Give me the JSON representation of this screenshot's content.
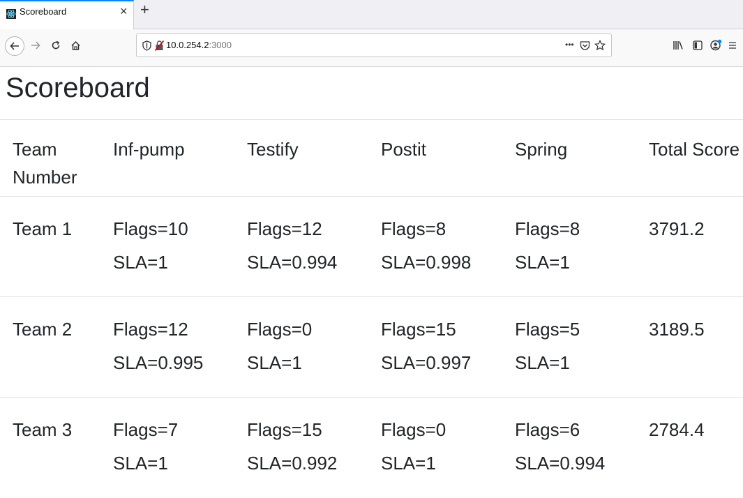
{
  "browser": {
    "tab_title": "Scoreboard",
    "tab_close": "×",
    "new_tab": "+",
    "url_host": "10.0.254.2",
    "url_port": ":3000",
    "more_label": "•••"
  },
  "page": {
    "title": "Scoreboard"
  },
  "table": {
    "headers": [
      "Team Number",
      "Inf-pump",
      "Testify",
      "Postit",
      "Spring",
      "Total Score"
    ],
    "rows": [
      {
        "team": "Team 1",
        "cells": [
          {
            "flags": "Flags=10",
            "sla": "SLA=1"
          },
          {
            "flags": "Flags=12",
            "sla": "SLA=0.994"
          },
          {
            "flags": "Flags=8",
            "sla": "SLA=0.998"
          },
          {
            "flags": "Flags=8",
            "sla": "SLA=1"
          }
        ],
        "total": "3791.2"
      },
      {
        "team": "Team 2",
        "cells": [
          {
            "flags": "Flags=12",
            "sla": "SLA=0.995"
          },
          {
            "flags": "Flags=0",
            "sla": "SLA=1"
          },
          {
            "flags": "Flags=15",
            "sla": "SLA=0.997"
          },
          {
            "flags": "Flags=5",
            "sla": "SLA=1"
          }
        ],
        "total": "3189.5"
      },
      {
        "team": "Team 3",
        "cells": [
          {
            "flags": "Flags=7",
            "sla": "SLA=1"
          },
          {
            "flags": "Flags=15",
            "sla": "SLA=0.992"
          },
          {
            "flags": "Flags=0",
            "sla": "SLA=1"
          },
          {
            "flags": "Flags=6",
            "sla": "SLA=0.994"
          }
        ],
        "total": "2784.4"
      }
    ]
  },
  "icons": {
    "favicon": "react-icon",
    "back": "back-arrow-icon",
    "forward": "forward-arrow-icon",
    "reload": "reload-icon",
    "home": "home-icon",
    "shield": "tracking-shield-icon",
    "insecure": "insecure-lock-icon",
    "pocket": "pocket-icon",
    "bookmark": "bookmark-star-icon",
    "library": "library-icon",
    "sidebar": "sidebar-icon",
    "account": "account-icon",
    "menu": "hamburger-menu-icon"
  },
  "colors": {
    "accent": "#0a84ff",
    "text": "#212529",
    "border": "#dee2e6"
  }
}
